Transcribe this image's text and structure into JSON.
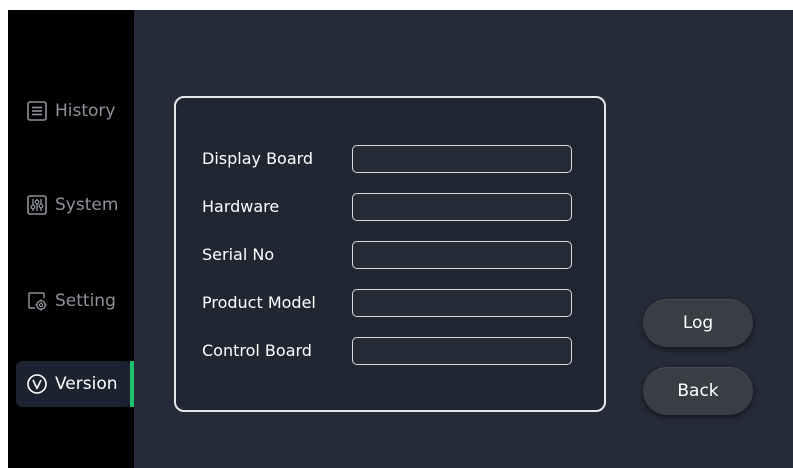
{
  "sidebar": {
    "items": [
      {
        "label": "History",
        "icon": "list-icon"
      },
      {
        "label": "System",
        "icon": "sliders-icon"
      },
      {
        "label": "Setting",
        "icon": "gear-screen-icon"
      },
      {
        "label": "Version",
        "icon": "version-v-icon",
        "active": true
      }
    ]
  },
  "version_panel": {
    "fields": [
      {
        "label": "Display Board",
        "value": ""
      },
      {
        "label": "Hardware",
        "value": ""
      },
      {
        "label": "Serial No",
        "value": ""
      },
      {
        "label": "Product Model",
        "value": ""
      },
      {
        "label": "Control Board",
        "value": ""
      }
    ]
  },
  "buttons": {
    "log": "Log",
    "back": "Back"
  },
  "colors": {
    "screen_bg": "#252b38",
    "sidebar_bg": "#000000",
    "accent": "#1fc36b",
    "button_bg": "#393d44"
  }
}
